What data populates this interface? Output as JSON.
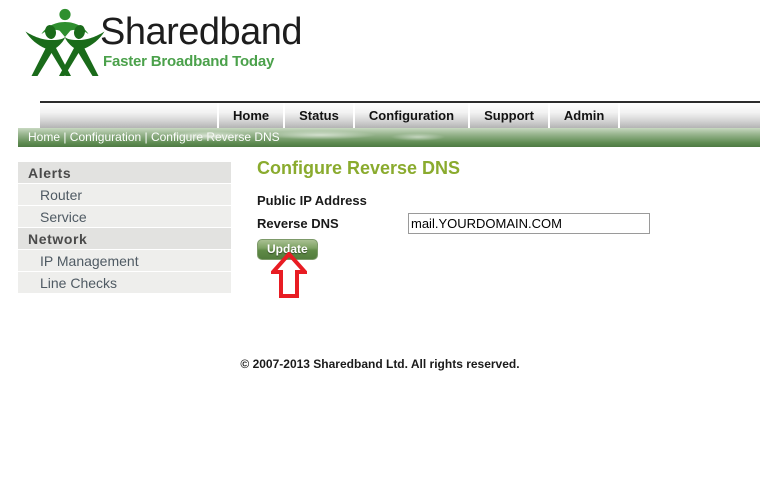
{
  "brand": {
    "name": "Sharedband",
    "tagline": "Faster Broadband Today",
    "logo_icon": "three-people-logo-icon",
    "green_accent": "#4ba14b",
    "dark_green": "#1f6b1f"
  },
  "nav": {
    "items": [
      {
        "label": "Home"
      },
      {
        "label": "Status"
      },
      {
        "label": "Configuration"
      },
      {
        "label": "Support"
      },
      {
        "label": "Admin"
      }
    ]
  },
  "breadcrumb": {
    "text": "Home | Configuration | Configure Reverse DNS"
  },
  "sidebar": {
    "groups": [
      {
        "title": "Alerts",
        "items": [
          {
            "label": "Router"
          },
          {
            "label": "Service"
          }
        ]
      },
      {
        "title": "Network",
        "items": [
          {
            "label": "IP Management"
          },
          {
            "label": "Line Checks"
          }
        ]
      }
    ]
  },
  "main": {
    "title": "Configure Reverse DNS",
    "public_ip_label": "Public IP Address",
    "public_ip_value": "",
    "reverse_dns_label": "Reverse DNS",
    "reverse_dns_value": "mail.YOURDOMAIN.COM",
    "update_label": "Update"
  },
  "annotation": {
    "arrow_icon": "red-up-arrow-icon",
    "color": "#e81c23"
  },
  "footer": {
    "copyright": "© 2007-2013 Sharedband Ltd. All rights reserved."
  },
  "colors": {
    "title_green": "#8aab2e",
    "breadcrumb_green": "#5f8c52",
    "button_green": "#5f8a46"
  }
}
